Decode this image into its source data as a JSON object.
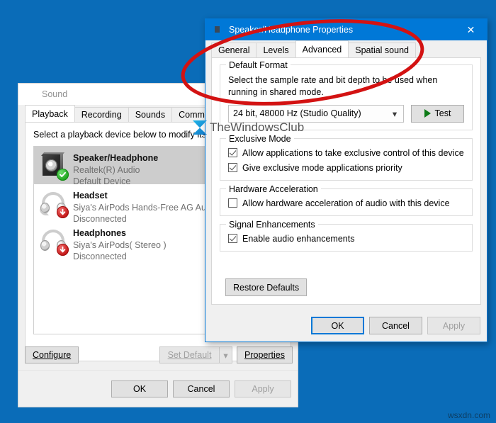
{
  "desktop": {
    "background_color": "#0a6cb8"
  },
  "watermarks": {
    "brand": "TheWindowsClub",
    "site": "wsxdn.com"
  },
  "annotation": {
    "shape": "ellipse",
    "color": "#d31212",
    "target": "Advanced tab"
  },
  "sound_window": {
    "title": "Sound",
    "title_icon": "speaker-icon",
    "active": false,
    "tabs": [
      {
        "label": "Playback",
        "active": true
      },
      {
        "label": "Recording",
        "active": false
      },
      {
        "label": "Sounds",
        "active": false
      },
      {
        "label": "Communications",
        "active": false
      }
    ],
    "description": "Select a playback device below to modify its settings:",
    "devices": [
      {
        "name": "Speaker/Headphone",
        "driver": "Realtek(R) Audio",
        "status": "Default Device",
        "icon": "speaker-icon",
        "badge": "check-badge-icon",
        "selected": true
      },
      {
        "name": "Headset",
        "driver": "Siya's AirPods Hands-Free AG Audio",
        "status": "Disconnected",
        "icon": "headset-icon",
        "badge": "down-arrow-badge-icon",
        "selected": false
      },
      {
        "name": "Headphones",
        "driver": "Siya's AirPods( Stereo )",
        "status": "Disconnected",
        "icon": "headphones-icon",
        "badge": "down-arrow-badge-icon",
        "selected": false
      }
    ],
    "actions": {
      "configure": "Configure",
      "set_default": "Set Default",
      "set_default_enabled": false,
      "properties": "Properties"
    },
    "footer": {
      "ok": "OK",
      "cancel": "Cancel",
      "apply": "Apply",
      "apply_enabled": false
    }
  },
  "properties_dialog": {
    "title": "Speaker/Headphone Properties",
    "title_icon": "speaker-properties-icon",
    "close_icon": "close-icon",
    "active": true,
    "accent_color": "#0078d7",
    "tabs": [
      {
        "label": "General",
        "active": false
      },
      {
        "label": "Levels",
        "active": false
      },
      {
        "label": "Advanced",
        "active": true
      },
      {
        "label": "Spatial sound",
        "active": false
      }
    ],
    "default_format": {
      "legend": "Default Format",
      "hint": "Select the sample rate and bit depth to be used when running in shared mode.",
      "selected": "24 bit, 48000 Hz (Studio Quality)",
      "dropdown_icon": "chevron-down-icon",
      "test_label": "Test",
      "test_icon": "play-icon"
    },
    "exclusive_mode": {
      "legend": "Exclusive Mode",
      "options": [
        {
          "label": "Allow applications to take exclusive control of this device",
          "checked": true
        },
        {
          "label": "Give exclusive mode applications priority",
          "checked": true
        }
      ]
    },
    "hardware_acceleration": {
      "legend": "Hardware Acceleration",
      "options": [
        {
          "label": "Allow hardware acceleration of audio with this device",
          "checked": false
        }
      ]
    },
    "signal_enhancements": {
      "legend": "Signal Enhancements",
      "options": [
        {
          "label": "Enable audio enhancements",
          "checked": true
        }
      ]
    },
    "restore_defaults": "Restore Defaults",
    "footer": {
      "ok": "OK",
      "cancel": "Cancel",
      "apply": "Apply",
      "apply_enabled": false
    }
  }
}
